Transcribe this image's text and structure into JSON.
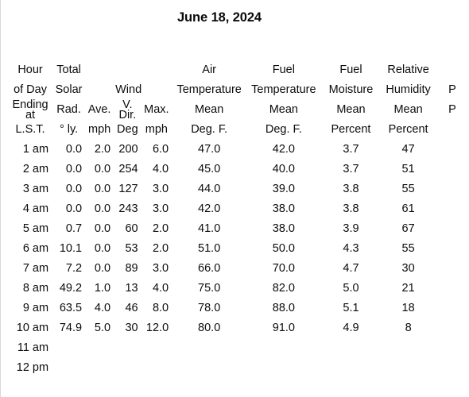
{
  "report": {
    "title": "June 18, 2024"
  },
  "table": {
    "header": {
      "line1": {
        "hour": "Hour",
        "solar": "Total",
        "wind": "",
        "air_temp": "Air",
        "fuel_temp": "Fuel",
        "fuel_moisture": "Fuel",
        "rel_humidity": "Relative",
        "precip": ""
      },
      "line2": {
        "hour": "of Day",
        "solar": "Solar",
        "wind": "Wind",
        "air_temp": "Temperature",
        "fuel_temp": "Temperature",
        "fuel_moisture": "Moisture",
        "rel_humidity": "Humidity",
        "precip": "P"
      },
      "line3": {
        "hour_a": "Ending",
        "hour_b": "at",
        "solar": "Rad.",
        "wind_ave": "Ave.",
        "wind_dir_a": "V.",
        "wind_dir_b": "Dir.",
        "wind_max": "Max.",
        "air_temp": "Mean",
        "fuel_temp": "Mean",
        "fuel_moisture": "Mean",
        "rel_humidity": "Mean",
        "precip": "P"
      },
      "units": {
        "hour": "L.S.T.",
        "solar": "° ly.",
        "wind_ave": "mph",
        "wind_dir": "Deg",
        "wind_max": "mph",
        "air_temp": "Deg. F.",
        "fuel_temp": "Deg. F.",
        "fuel_moisture": "Percent",
        "rel_humidity": "Percent",
        "precip": ""
      }
    },
    "columns": [
      "Hour of Day Ending at (L.S.T.)",
      "Total Solar Rad. (° ly.)",
      "Wind Ave. (mph)",
      "Wind V. Dir. (Deg)",
      "Wind Max. (mph)",
      "Air Temperature Mean (Deg. F.)",
      "Fuel Temperature Mean (Deg. F.)",
      "Fuel Moisture Mean (Percent)",
      "Relative Humidity Mean (Percent)"
    ],
    "rows": [
      {
        "hour": "1 am",
        "solar": "0.0",
        "wind_ave": "2.0",
        "wind_dir": "200",
        "wind_max": "6.0",
        "air_temp": "47.0",
        "fuel_temp": "42.0",
        "fuel_moisture": "3.7",
        "rel_humidity": "47"
      },
      {
        "hour": "2 am",
        "solar": "0.0",
        "wind_ave": "0.0",
        "wind_dir": "254",
        "wind_max": "4.0",
        "air_temp": "45.0",
        "fuel_temp": "40.0",
        "fuel_moisture": "3.7",
        "rel_humidity": "51"
      },
      {
        "hour": "3 am",
        "solar": "0.0",
        "wind_ave": "0.0",
        "wind_dir": "127",
        "wind_max": "3.0",
        "air_temp": "44.0",
        "fuel_temp": "39.0",
        "fuel_moisture": "3.8",
        "rel_humidity": "55"
      },
      {
        "hour": "4 am",
        "solar": "0.0",
        "wind_ave": "0.0",
        "wind_dir": "243",
        "wind_max": "3.0",
        "air_temp": "42.0",
        "fuel_temp": "38.0",
        "fuel_moisture": "3.8",
        "rel_humidity": "61"
      },
      {
        "hour": "5 am",
        "solar": "0.7",
        "wind_ave": "0.0",
        "wind_dir": "60",
        "wind_max": "2.0",
        "air_temp": "41.0",
        "fuel_temp": "38.0",
        "fuel_moisture": "3.9",
        "rel_humidity": "67"
      },
      {
        "hour": "6 am",
        "solar": "10.1",
        "wind_ave": "0.0",
        "wind_dir": "53",
        "wind_max": "2.0",
        "air_temp": "51.0",
        "fuel_temp": "50.0",
        "fuel_moisture": "4.3",
        "rel_humidity": "55"
      },
      {
        "hour": "7 am",
        "solar": "7.2",
        "wind_ave": "0.0",
        "wind_dir": "89",
        "wind_max": "3.0",
        "air_temp": "66.0",
        "fuel_temp": "70.0",
        "fuel_moisture": "4.7",
        "rel_humidity": "30"
      },
      {
        "hour": "8 am",
        "solar": "49.2",
        "wind_ave": "1.0",
        "wind_dir": "13",
        "wind_max": "4.0",
        "air_temp": "75.0",
        "fuel_temp": "82.0",
        "fuel_moisture": "5.0",
        "rel_humidity": "21"
      },
      {
        "hour": "9 am",
        "solar": "63.5",
        "wind_ave": "4.0",
        "wind_dir": "46",
        "wind_max": "8.0",
        "air_temp": "78.0",
        "fuel_temp": "88.0",
        "fuel_moisture": "5.1",
        "rel_humidity": "18"
      },
      {
        "hour": "10 am",
        "solar": "74.9",
        "wind_ave": "5.0",
        "wind_dir": "30",
        "wind_max": "12.0",
        "air_temp": "80.0",
        "fuel_temp": "91.0",
        "fuel_moisture": "4.9",
        "rel_humidity": "8"
      },
      {
        "hour": "11 am",
        "solar": "",
        "wind_ave": "",
        "wind_dir": "",
        "wind_max": "",
        "air_temp": "",
        "fuel_temp": "",
        "fuel_moisture": "",
        "rel_humidity": ""
      },
      {
        "hour": "12 pm",
        "solar": "",
        "wind_ave": "",
        "wind_dir": "",
        "wind_max": "",
        "air_temp": "",
        "fuel_temp": "",
        "fuel_moisture": "",
        "rel_humidity": ""
      }
    ]
  }
}
